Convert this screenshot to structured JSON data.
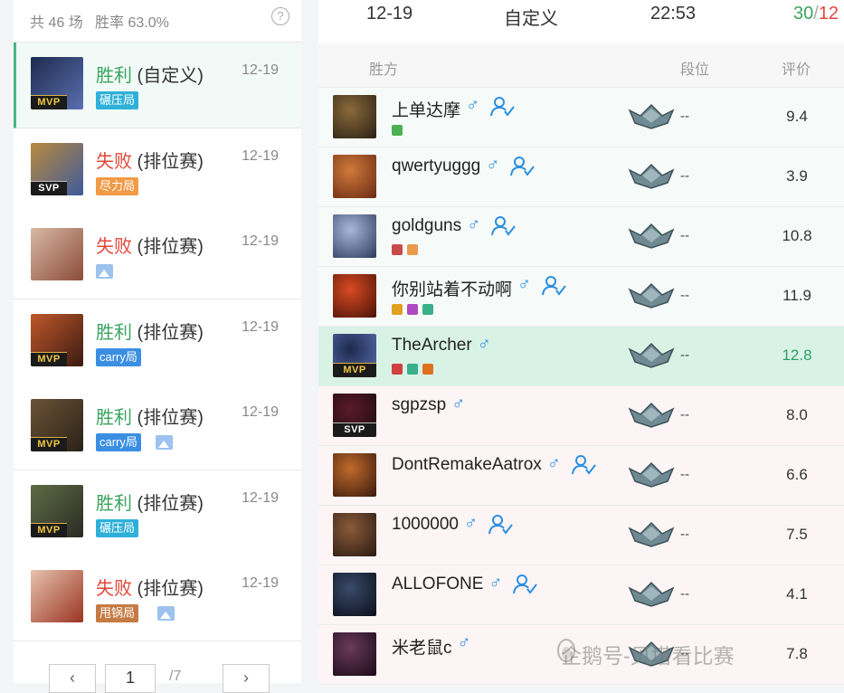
{
  "summary": {
    "text": "共 46 场   胜率 63.0%",
    "help": "?"
  },
  "matches": [
    {
      "result": "胜利",
      "mode": " (自定义)",
      "date": "12-19",
      "badge": "MVP",
      "tag": "碾压局",
      "tag_color": "cyan",
      "pic": false,
      "outcome": "win",
      "avatar_colors": [
        "#1d2a4e",
        "#5a6fb0"
      ]
    },
    {
      "result": "失败",
      "mode": " (排位赛)",
      "date": "12-19",
      "badge": "SVP",
      "tag": "尽力局",
      "tag_color": "orange",
      "pic": false,
      "outcome": "loss",
      "avatar_colors": [
        "#b98a3e",
        "#3e5a9a"
      ]
    },
    {
      "result": "失败",
      "mode": " (排位赛)",
      "date": "12-19",
      "badge": "",
      "tag": "",
      "tag_color": "",
      "pic": true,
      "outcome": "loss",
      "avatar_colors": [
        "#d8b8a2",
        "#8b4c3a"
      ]
    },
    {
      "result": "胜利",
      "mode": " (排位赛)",
      "date": "12-19",
      "badge": "MVP",
      "tag": "carry局",
      "tag_color": "blue",
      "pic": false,
      "outcome": "win",
      "avatar_colors": [
        "#c0572a",
        "#3a1b12"
      ]
    },
    {
      "result": "胜利",
      "mode": " (排位赛)",
      "date": "12-19",
      "badge": "MVP",
      "tag": "carry局",
      "tag_color": "blue",
      "pic": true,
      "outcome": "win",
      "avatar_colors": [
        "#6b5236",
        "#2b2218"
      ]
    },
    {
      "result": "胜利",
      "mode": " (排位赛)",
      "date": "12-19",
      "badge": "MVP",
      "tag": "碾压局",
      "tag_color": "cyan",
      "pic": false,
      "outcome": "win",
      "avatar_colors": [
        "#5e6b46",
        "#2a2b22"
      ]
    },
    {
      "result": "失败",
      "mode": " (排位赛)",
      "date": "12-19",
      "badge": "",
      "tag": "甩锅局",
      "tag_color": "brown",
      "pic": true,
      "outcome": "loss",
      "avatar_colors": [
        "#e7c3ad",
        "#9a3422"
      ]
    }
  ],
  "pager": {
    "prev": "‹",
    "page": "1",
    "total": "/7",
    "next": "›"
  },
  "detail": {
    "date": "12-19",
    "mode": "自定义",
    "time": "22:53",
    "score_kills": "30",
    "score_sep": "/",
    "score_deaths": "12",
    "headers": {
      "side": "胜方",
      "rank": "段位",
      "rating": "评价"
    }
  },
  "players": [
    {
      "name": "上单达摩",
      "friend": true,
      "side": "win",
      "me": false,
      "badge": "",
      "rank": "--",
      "score": "9.4",
      "sub_icons": [
        "#4caf50"
      ],
      "avatar_colors": [
        "#8a6a3a",
        "#2a2015"
      ]
    },
    {
      "name": "qwertyuggg",
      "friend": true,
      "side": "win",
      "me": false,
      "badge": "",
      "rank": "--",
      "score": "3.9",
      "sub_icons": [],
      "avatar_colors": [
        "#d07a3a",
        "#6a2a14"
      ]
    },
    {
      "name": "goldguns",
      "friend": true,
      "side": "win",
      "me": false,
      "badge": "",
      "rank": "--",
      "score": "10.8",
      "sub_icons": [
        "#c94a4a",
        "#e89a4a"
      ],
      "avatar_colors": [
        "#a8b8d8",
        "#2d3a5e"
      ]
    },
    {
      "name": "你别站着不动啊",
      "friend": true,
      "side": "win",
      "me": false,
      "badge": "",
      "rank": "--",
      "score": "11.9",
      "sub_icons": [
        "#e0a020",
        "#b04ac0",
        "#3ab08a"
      ],
      "avatar_colors": [
        "#d84a22",
        "#4a1208"
      ]
    },
    {
      "name": "TheArcher",
      "friend": false,
      "side": "win",
      "me": true,
      "badge": "MVP",
      "rank": "--",
      "score": "12.8",
      "sub_icons": [
        "#d04040",
        "#3ab08a",
        "#e07020"
      ],
      "avatar_colors": [
        "#1d2a4e",
        "#5a6fb0"
      ]
    },
    {
      "name": "sgpzsp",
      "friend": false,
      "side": "loss",
      "me": false,
      "badge": "SVP",
      "rank": "--",
      "score": "8.0",
      "sub_icons": [],
      "avatar_colors": [
        "#5a1a2a",
        "#1a0a10"
      ]
    },
    {
      "name": "DontRemakeAatrox",
      "friend": true,
      "side": "loss",
      "me": false,
      "badge": "",
      "rank": "--",
      "score": "6.6",
      "sub_icons": [],
      "avatar_colors": [
        "#c06a2a",
        "#3a1a10"
      ]
    },
    {
      "name": "1000000",
      "friend": true,
      "side": "loss",
      "me": false,
      "badge": "",
      "rank": "--",
      "score": "7.5",
      "sub_icons": [],
      "avatar_colors": [
        "#8a5a3a",
        "#2a1a12"
      ]
    },
    {
      "name": "ALLOFONE",
      "friend": true,
      "side": "loss",
      "me": false,
      "badge": "",
      "rank": "--",
      "score": "4.1",
      "sub_icons": [],
      "avatar_colors": [
        "#3a4a6a",
        "#0a0f1a"
      ]
    },
    {
      "name": "米老鼠c",
      "friend": false,
      "side": "loss",
      "me": false,
      "badge": "",
      "rank": "--",
      "score": "7.8",
      "sub_icons": [],
      "avatar_colors": [
        "#6a3a5a",
        "#1a0a18"
      ]
    }
  ],
  "watermark": "企鹅号-贝塔看比赛",
  "colors": {
    "win_green": "#3aa45e",
    "loss_red": "#e2473a",
    "male_blue": "#2b8ee0",
    "selected_bar": "#48b887"
  }
}
